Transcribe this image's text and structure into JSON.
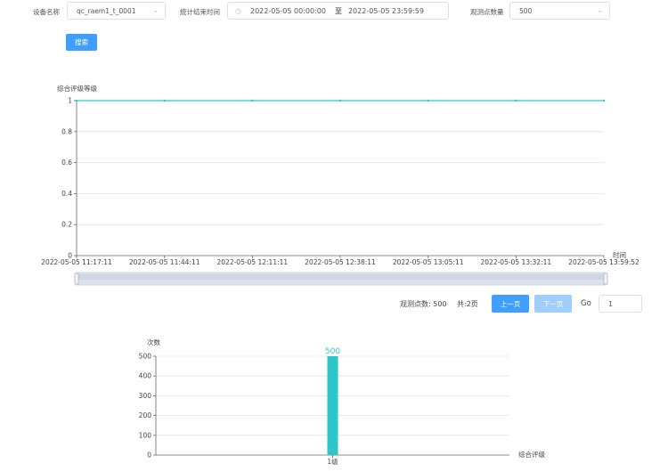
{
  "filters": {
    "device_label": "设备名称",
    "device_value": "qc_raem1_t_0001",
    "time_label": "统计结束时间",
    "time_start": "2022-05-05 00:00:00",
    "time_sep": "至",
    "time_end": "2022-05-05 23:59:59",
    "count_label": "观测点数量",
    "count_value": "500",
    "search_label": "搜索"
  },
  "line_chart": {
    "ylabel": "综合评级等级",
    "xlabel": "时间",
    "yticks": [
      "0",
      "0.2",
      "0.4",
      "0.6",
      "0.8",
      "1"
    ],
    "xticks": [
      "2022-05-05 11:17:11",
      "2022-05-05 11:44:11",
      "2022-05-05 12:11:11",
      "2022-05-05 12:38:11",
      "2022-05-05 13:05:11",
      "2022-05-05 13:32:11",
      "2022-05-05 13:59:52"
    ]
  },
  "pagination": {
    "points_text": "观测点数: 500",
    "pages_text": "共:2页",
    "prev_label": "上一页",
    "next_label": "下一页",
    "go_label": "Go",
    "page_value": "1"
  },
  "bar_chart": {
    "ylabel": "次数",
    "xlabel": "综合评级",
    "yticks": [
      "0",
      "100",
      "200",
      "300",
      "400",
      "500"
    ]
  },
  "chart_data": [
    {
      "type": "line",
      "title": "",
      "xlabel": "时间",
      "ylabel": "综合评级等级",
      "ylim": [
        0,
        1
      ],
      "x": [
        "2022-05-05 11:17:11",
        "2022-05-05 11:44:11",
        "2022-05-05 12:11:11",
        "2022-05-05 12:38:11",
        "2022-05-05 13:05:11",
        "2022-05-05 13:32:11",
        "2022-05-05 13:59:52"
      ],
      "y": [
        1,
        1,
        1,
        1,
        1,
        1,
        1
      ],
      "color": "#2ec7c9",
      "grid": true
    },
    {
      "type": "bar",
      "title": "",
      "categories": [
        "1级"
      ],
      "values": [
        500
      ],
      "data_labels": [
        "500"
      ],
      "xlabel": "综合评级",
      "ylabel": "次数",
      "ylim": [
        0,
        500
      ],
      "color": "#2ec7c9",
      "grid": true
    }
  ]
}
